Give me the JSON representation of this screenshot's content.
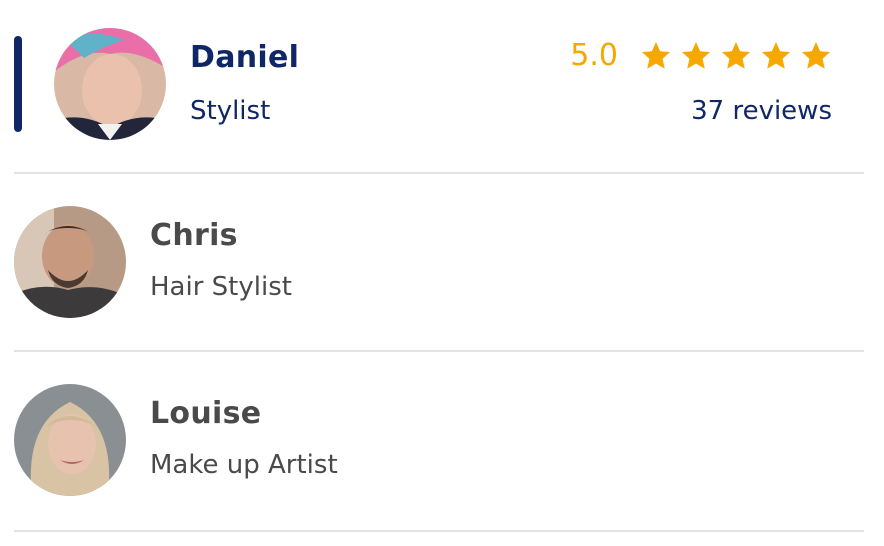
{
  "accent_color": "#0f2766",
  "star_color": "#f5a800",
  "staff": [
    {
      "name": "Daniel",
      "role": "Stylist",
      "selected": true,
      "rating": "5.0",
      "stars": 5,
      "reviews": "37 reviews",
      "avatar": "avatar-photo"
    },
    {
      "name": "Chris",
      "role": "Hair Stylist",
      "selected": false,
      "avatar": "avatar-photo"
    },
    {
      "name": "Louise",
      "role": "Make up Artist",
      "selected": false,
      "avatar": "avatar-photo"
    }
  ]
}
